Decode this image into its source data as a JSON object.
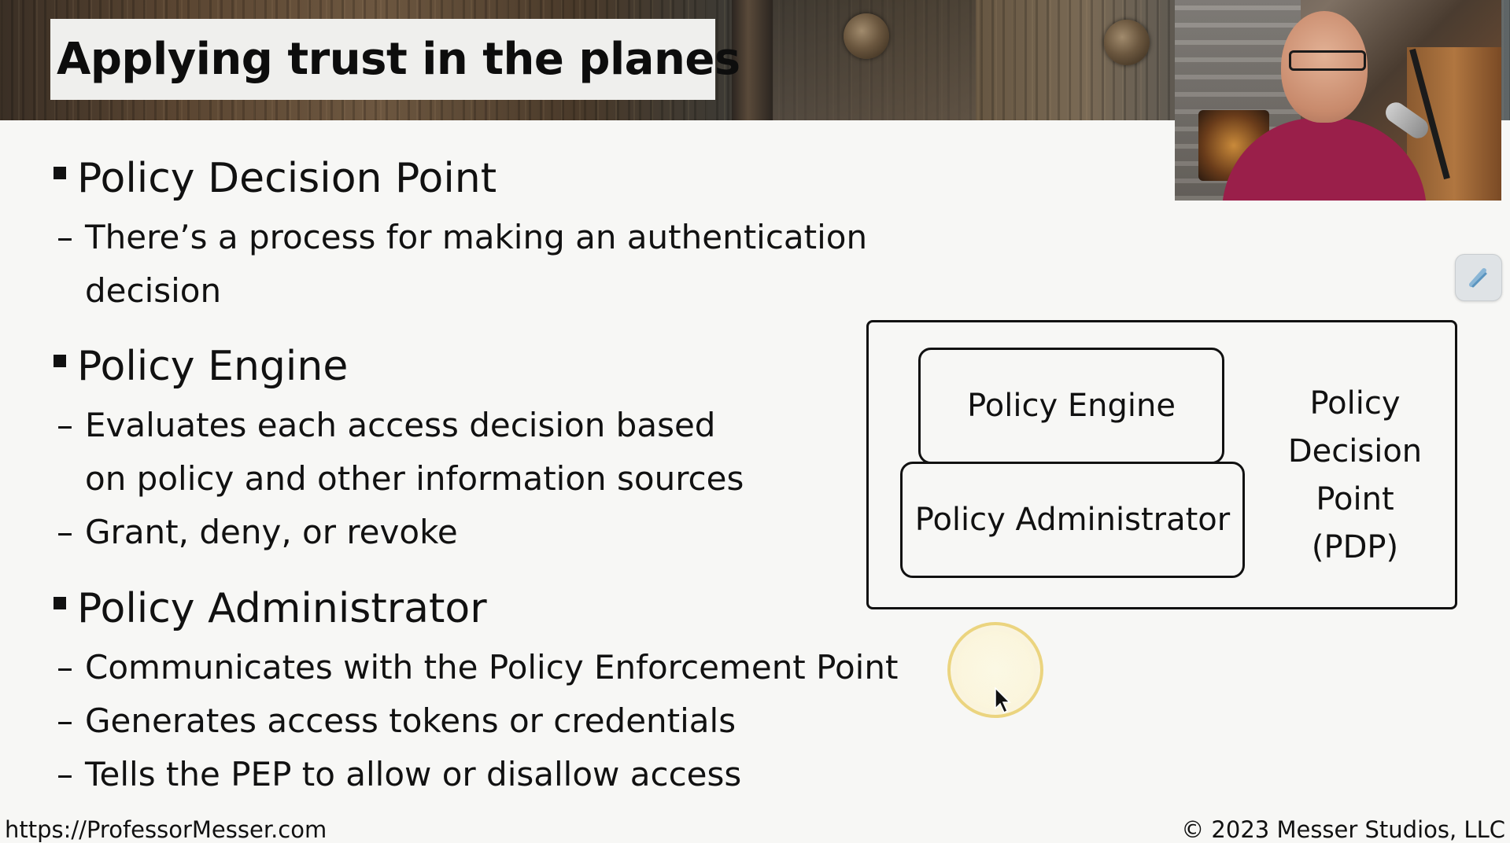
{
  "slide": {
    "title": "Applying trust in the planes",
    "sections": [
      {
        "heading": "Policy Decision Point",
        "points": [
          {
            "line1": "There’s a process for making an authentication",
            "line2": "decision"
          }
        ]
      },
      {
        "heading": "Policy Engine",
        "points": [
          {
            "line1": "Evaluates each access decision based",
            "line2": "on policy and other information sources"
          },
          {
            "line1": "Grant, deny, or revoke"
          }
        ]
      },
      {
        "heading": "Policy Administrator",
        "points": [
          {
            "line1": "Communicates with the Policy Enforcement Point"
          },
          {
            "line1": "Generates access tokens or credentials"
          },
          {
            "line1": "Tells the PEP to allow or disallow access"
          }
        ]
      }
    ]
  },
  "diagram": {
    "engine_label": "Policy Engine",
    "administrator_label": "Policy Administrator",
    "pdp_label_lines": [
      "Policy",
      "Decision",
      "Point",
      "(PDP)"
    ]
  },
  "footer": {
    "url": "https://ProfessorMesser.com",
    "copyright": "© 2023 Messer Studios, LLC"
  },
  "icons": {
    "side_tool": "pen-tool-icon",
    "cursor": "mouse-pointer-icon"
  },
  "colors": {
    "background": "#f7f7f5",
    "text": "#111111",
    "cursor_highlight": "#e8ce6e"
  }
}
